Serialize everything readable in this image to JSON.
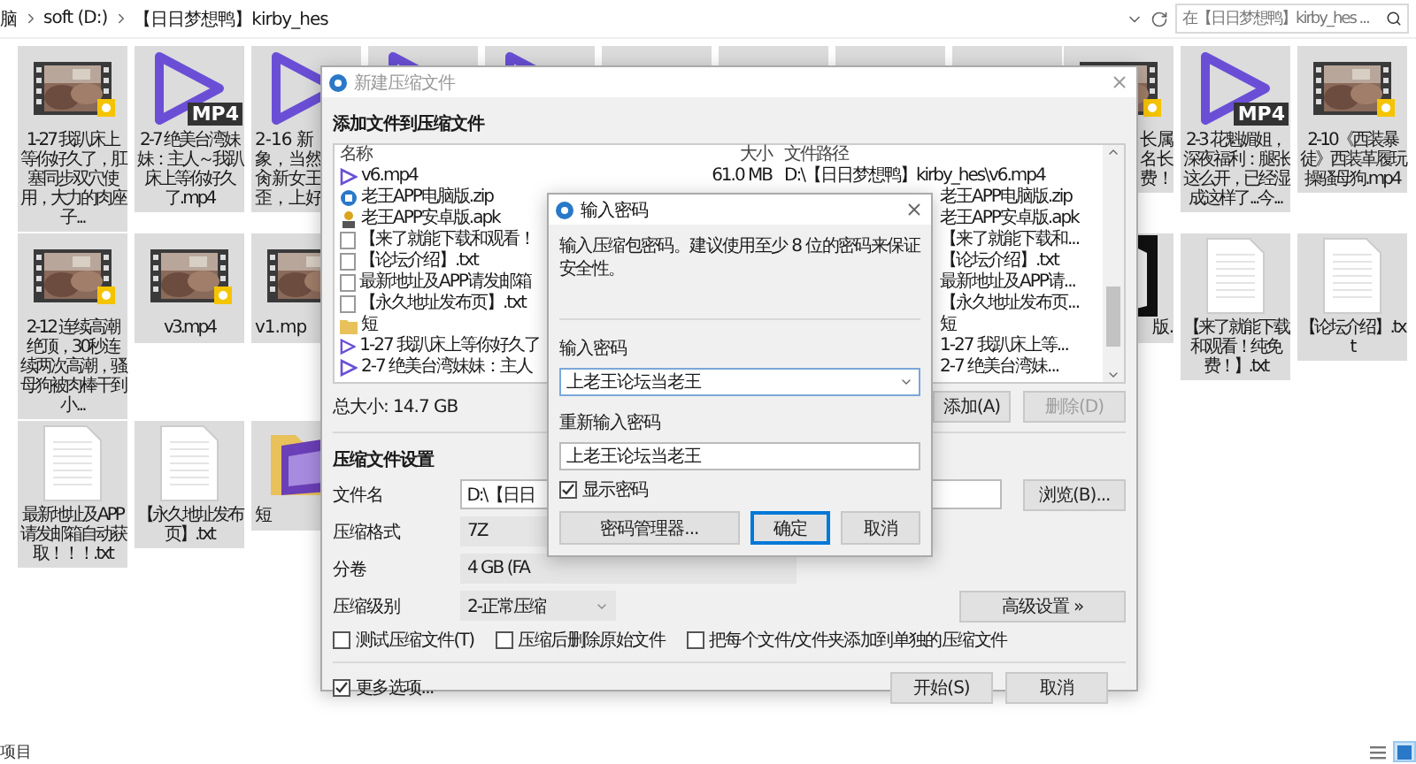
{
  "explorer": {
    "breadcrumb": [
      "脑",
      "soft (D:)",
      "【日日梦想鸭】kirby_hes"
    ],
    "search": {
      "placeholder": "在【日日梦想鸭】kirby_hes ..."
    },
    "rows": [
      {
        "left": [
          {
            "kind": "video",
            "label": "1-27 我趴床上等你好久了，肛塞同步双穴使用，大力的肉座子..."
          },
          {
            "kind": "mp4",
            "badge": "MP4",
            "label": "2-7 绝美台湾妹妹：主人～我趴床上等你好久了.mp4"
          },
          {
            "kind": "mp4",
            "lines": [
              "2-16 新",
              "象，当然",
              "肏新女王",
              "歪，上好"
            ]
          },
          {
            "kind": "mp4"
          },
          {
            "kind": "mp4"
          },
          {
            "kind": "blank"
          },
          {
            "kind": "blank"
          },
          {
            "kind": "blank"
          },
          {
            "kind": "blank"
          }
        ],
        "right": [
          {
            "kind": "video",
            "lines": [
              "长属",
              "名长",
              "费！"
            ]
          },
          {
            "kind": "mp4",
            "badge": "MP4",
            "label": "2-3 花魁媚姐，深夜福利：腿张这么开，已经湿成这样了...今..."
          },
          {
            "kind": "video",
            "label": "2-10《西装暴徒》西装革履玩操骚母狗.mp4"
          }
        ]
      },
      {
        "left": [
          {
            "kind": "video",
            "label": "2-12 连续高潮绝顶，30秒连续两次高潮，骚母狗被肉棒干到小..."
          },
          {
            "kind": "video",
            "label": "v3.mp4"
          },
          {
            "kind": "video",
            "player_badge": false,
            "lines": [
              "v1.mp"
            ]
          }
        ],
        "right": [
          {
            "lines": [
              "版."
            ]
          },
          {
            "kind": "txt",
            "label": "【来了就能下载和观看！纯免费！】.txt"
          },
          {
            "kind": "txt",
            "label": "【论坛介绍】.txt"
          }
        ]
      },
      {
        "left": [
          {
            "kind": "txt",
            "label": "最新地址及APP请发邮箱自动获取！！！.txt"
          },
          {
            "kind": "txt",
            "label": "【永久地址发布页】.txt"
          },
          {
            "kind": "folder",
            "lines": [
              "短"
            ]
          }
        ],
        "right": []
      }
    ],
    "status_bar": {
      "text": "项目"
    },
    "views": [
      {
        "kind": "details",
        "selected": false
      },
      {
        "kind": "icons",
        "selected": true
      }
    ]
  },
  "compress_dialog": {
    "title": "新建压缩文件",
    "active": false,
    "heading": "添加文件到压缩文件",
    "columns": [
      "名称",
      "大小",
      "文件路径"
    ],
    "files": [
      {
        "kind": "video",
        "name": "v6.mp4",
        "size": "61.0 MB",
        "path": "D:\\【日日梦想鸭】kirby_hes\\v6.mp4"
      },
      {
        "kind": "zip",
        "name": "老王APP电脑版.zip",
        "path": "老王APP电脑版.zip"
      },
      {
        "kind": "apk",
        "name": "老王APP安卓版.apk",
        "path": "老王APP安卓版.apk"
      },
      {
        "kind": "txt",
        "name": "【来了就能下载和观看！",
        "path": "【来了就能下载和..."
      },
      {
        "kind": "txt",
        "name": "【论坛介绍】.txt",
        "path": "【论坛介绍】.txt"
      },
      {
        "kind": "txt",
        "name": "最新地址及APP请发邮箱",
        "path": "最新地址及APP请..."
      },
      {
        "kind": "txt",
        "name": "【永久地址发布页】.txt",
        "path": "【永久地址发布页..."
      },
      {
        "kind": "folder",
        "name": "短",
        "path": "短"
      },
      {
        "kind": "video",
        "name": "1-27 我趴床上等你好久了",
        "path": "1-27 我趴床上等..."
      },
      {
        "kind": "video",
        "name": "2-7 绝美台湾妹妹：主人",
        "path": "2-7 绝美台湾妹..."
      }
    ],
    "total": "总大小: 14.7 GB",
    "add_button": {
      "label": "添加(A)",
      "disabled": false
    },
    "delete_button": {
      "label": "删除(D)",
      "disabled": true
    },
    "settings_heading": "压缩文件设置",
    "fields": [
      {
        "kind": "text",
        "label": "文件名",
        "value": "D:\\【日日"
      },
      {
        "kind": "wide-select",
        "label": "压缩格式",
        "value": "7Z"
      },
      {
        "kind": "wide-select",
        "label": "分卷",
        "value": "4 GB (FA"
      },
      {
        "kind": "select",
        "label": "压缩级别",
        "value": "2-正常压缩"
      }
    ],
    "browse_button": "浏览(B)...",
    "advanced_button": "高级设置 »",
    "options": [
      {
        "label": "测试压缩文件(T)",
        "checked": false
      },
      {
        "label": "压缩后删除原始文件",
        "checked": false
      },
      {
        "label": "把每个文件/文件夹添加到单独的压缩文件",
        "checked": false
      }
    ],
    "more_options": {
      "label": "更多选项...",
      "checked": true
    },
    "buttons": [
      "开始(S)",
      "取消"
    ]
  },
  "password_dialog": {
    "title": "输入密码",
    "hint": "输入压缩包密码。建议使用至少 8 位的密码来保证安全性。",
    "password_label": "输入密码",
    "password": "上老王论坛当老王",
    "confirm_label": "重新输入密码",
    "confirm": "上老王论坛当老王",
    "show_password": {
      "label": "显示密码",
      "checked": true
    },
    "buttons": [
      {
        "label": "密码管理器...",
        "default": false
      },
      {
        "label": "确定",
        "default": true
      },
      {
        "label": "取消",
        "default": false
      }
    ]
  }
}
